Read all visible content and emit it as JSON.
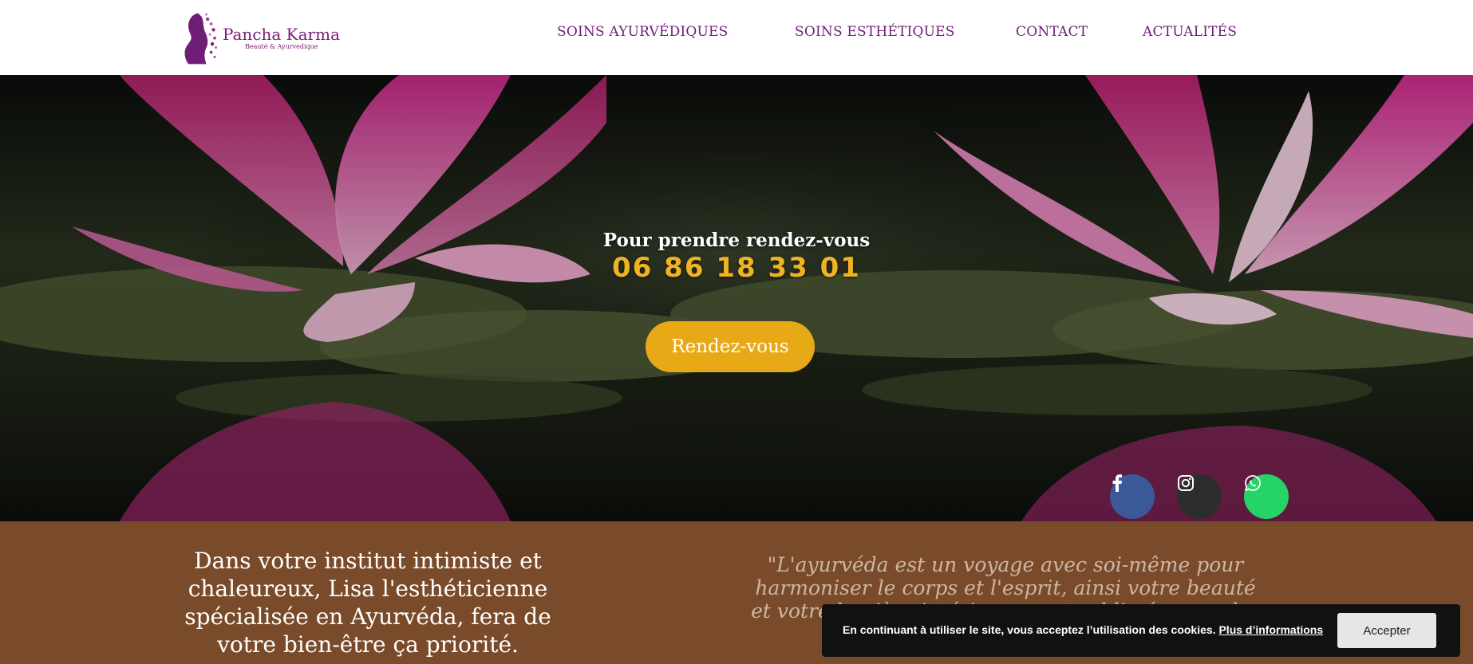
{
  "header": {
    "logo_name": "Pancha Karma",
    "logo_subtitle": "Beauté & Ayurvedique",
    "nav": [
      {
        "label": "SOINS AYURVÉDIQUES"
      },
      {
        "label": "SOINS ESTHÉTIQUES"
      },
      {
        "label": "CONTACT"
      },
      {
        "label": "ACTUALITÉS"
      }
    ]
  },
  "hero": {
    "label": "Pour prendre rendez-vous",
    "phone": "06 86 18 33 01",
    "button_label": "Rendez-vous",
    "social": [
      {
        "name": "facebook-icon",
        "color": "#3b5998"
      },
      {
        "name": "instagram-icon",
        "color": "#2d2d2d"
      },
      {
        "name": "whatsapp-icon",
        "color": "#25d366"
      }
    ]
  },
  "band": {
    "left_text": "Dans votre institut intimiste et chaleureux, Lisa l'esthéticienne spécialisée en Ayurvéda, fera de votre bien-être ça priorité.",
    "quote": "\"L'ayurvéda est un voyage avec soi-même pour harmoniser le corps et l'esprit, ainsi votre beauté et votre lumière intérieure sont sublimées par des soins naturels."
  },
  "cookie": {
    "text": "En continuant à utiliser le site, vous acceptez l’utilisation des cookies.",
    "link_label": "Plus d’informations",
    "accept_label": "Accepter"
  },
  "colors": {
    "brand_purple": "#7b1a78",
    "accent_gold": "#e8a916",
    "band_brown": "#7a4b2a"
  }
}
